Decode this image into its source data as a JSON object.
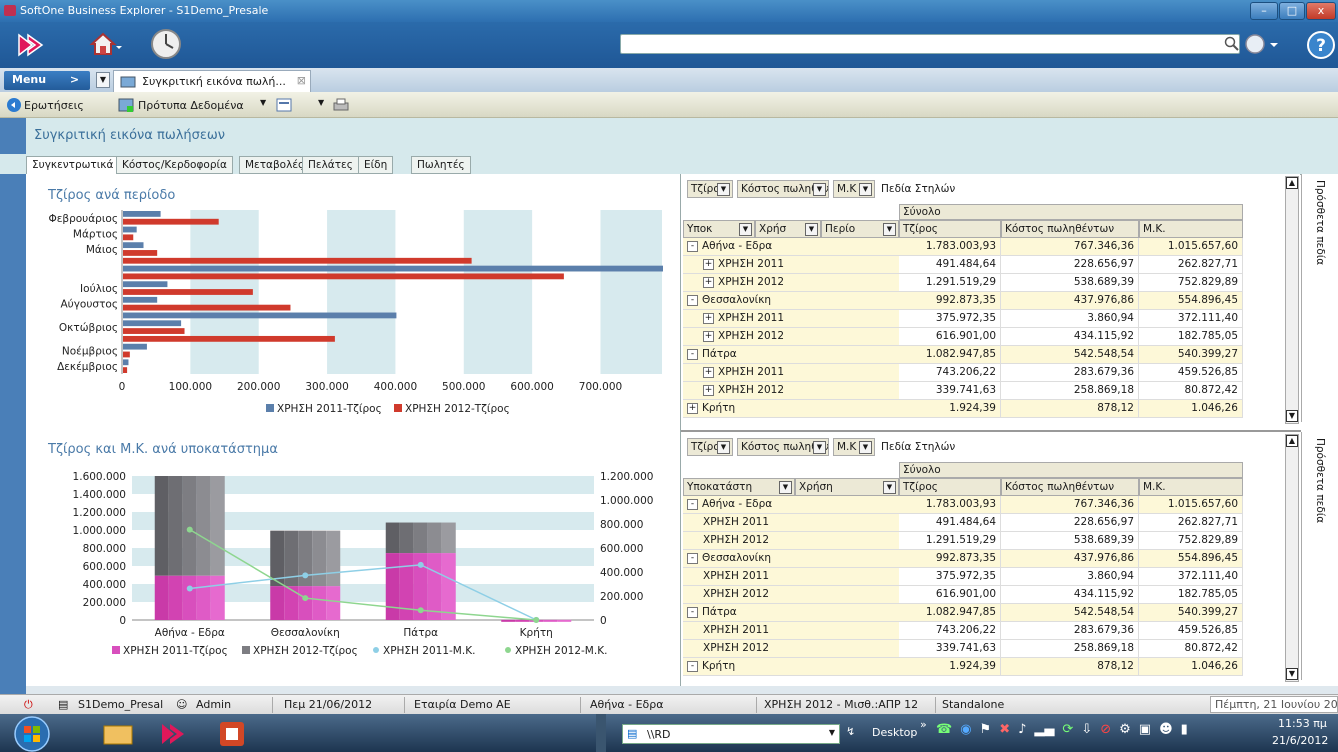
{
  "window": {
    "title": "SoftOne Business Explorer - S1Demo_Presale",
    "minimize": "–",
    "maximize": "□",
    "close": "x"
  },
  "menu": {
    "label": "Menu",
    "arrow": ">",
    "doc_tab": "Συγκριτική εικόνα πωλή..."
  },
  "commands": {
    "queries": "Ερωτήσεις",
    "templates": "Πρότυπα Δεδομένα"
  },
  "page_title": "Συγκριτική εικόνα πωλήσεων",
  "tabs": [
    "Συγκεντρωτικά",
    "Κόστος/Κερδοφορία",
    "Μεταβολές",
    "Πελάτες",
    "Είδη",
    "Πωλητές"
  ],
  "colors": {
    "blue": "#5b7fab",
    "red": "#d03a2c",
    "pink": "#d84fbd",
    "gray": "#7d7d82",
    "lightblue": "#8ecfe6",
    "green": "#8ed68f"
  },
  "chart1": {
    "title": "Τζίρος ανά περίοδο",
    "legend": [
      "ΧΡΗΣΗ 2011-Τζίρος",
      "ΧΡΗΣΗ 2012-Τζίρος"
    ],
    "tick_labels": [
      "0",
      "100.000",
      "200.000",
      "300.000",
      "400.000",
      "500.000",
      "600.000",
      "700.000"
    ]
  },
  "chart2": {
    "title": "Τζίρος και Μ.Κ. ανά υποκατάστημα",
    "left_ticks": [
      "1.600.000",
      "1.400.000",
      "1.200.000",
      "1.000.000",
      "800.000",
      "600.000",
      "400.000",
      "200.000",
      "0"
    ],
    "right_ticks": [
      "1.200.000",
      "1.000.000",
      "800.000",
      "600.000",
      "400.000",
      "200.000",
      "0"
    ],
    "legend": [
      "ΧΡΗΣΗ 2011-Τζίρος",
      "ΧΡΗΣΗ 2012-Τζίρος",
      "ΧΡΗΣΗ 2011-Μ.Κ.",
      "ΧΡΗΣΗ 2012-Μ.Κ."
    ]
  },
  "chart_data": [
    {
      "type": "bar",
      "orientation": "horizontal",
      "title": "Τζίρος ανά περίοδο",
      "categories": [
        "Φεβρουάριος",
        "Μάρτιος",
        "Μάιος",
        "Ιούλιος",
        "Αύγουστος",
        "Οκτώβριος",
        "Νοέμβριος",
        "Δεκέμβριος"
      ],
      "series": [
        {
          "name": "ΧΡΗΣΗ 2011-Τζίρος",
          "values": [
            55000,
            20000,
            30000,
            65000,
            50000,
            85000,
            35000,
            8000
          ]
        },
        {
          "name": "ΧΡΗΣΗ 2012-Τζίρος",
          "values": [
            140000,
            15000,
            50000,
            190000,
            245000,
            90000,
            10000,
            6000
          ]
        }
      ],
      "extra_bars": [
        {
          "after": "Μάιος",
          "series": "ΧΡΗΣΗ 2012-Τζίρος",
          "value": 510000
        },
        {
          "after": "Μάιος",
          "series": "ΧΡΗΣΗ 2011-Τζίρος",
          "value": 790000
        },
        {
          "after": "Μάιος",
          "series": "ΧΡΗΣΗ 2012-Τζίρος",
          "value": 645000
        },
        {
          "after": "Αύγουστος",
          "series": "ΧΡΗΣΗ 2011-Τζίρος",
          "value": 400000
        },
        {
          "after": "Οκτώβριος",
          "series": "ΧΡΗΣΗ 2012-Τζίρος",
          "value": 310000
        }
      ],
      "xlim": [
        0,
        790000
      ]
    },
    {
      "type": "bar",
      "stacked": true,
      "title": "Τζίρος και Μ.Κ. ανά υποκατάστημα",
      "categories": [
        "Αθήνα - Εδρα",
        "Θεσσαλονίκη",
        "Πάτρα",
        "Κρήτη"
      ],
      "series": [
        {
          "name": "ΧΡΗΣΗ 2011-Τζίρος",
          "values": [
            491484.64,
            375972.35,
            743206.22,
            1924.39
          ]
        },
        {
          "name": "ΧΡΗΣΗ 2012-Τζίρος",
          "values": [
            1291519.29,
            616901.0,
            339741.63,
            0
          ]
        }
      ],
      "lines": [
        {
          "name": "ΧΡΗΣΗ 2011-Μ.Κ.",
          "values": [
            262827.71,
            372111.4,
            459526.85,
            1046.26
          ]
        },
        {
          "name": "ΧΡΗΣΗ 2012-Μ.Κ.",
          "values": [
            752829.89,
            182785.05,
            80872.42,
            0
          ]
        }
      ],
      "ylim_left": [
        0,
        1600000
      ],
      "ylim_right": [
        0,
        1200000
      ]
    }
  ],
  "pivot1": {
    "fields": [
      "Τζίρος",
      "Κόστος πωληθέν",
      "Μ.Κ"
    ],
    "column_fields_label": "Πεδία Στηλών",
    "row_fields": [
      "Υποκ",
      "Χρήσ",
      "Περίο"
    ],
    "total_label": "Σύνολο",
    "headers": [
      "Τζίρος",
      "Κόστος πωληθέντων",
      "Μ.Κ."
    ],
    "side_label": "Πρόσθετα πεδία",
    "rows": [
      {
        "label": "Αθήνα - Εδρα",
        "level": 0,
        "sign": "-",
        "values": [
          "1.783.003,93",
          "767.346,36",
          "1.015.657,60"
        ]
      },
      {
        "label": "ΧΡΗΣΗ 2011",
        "level": 1,
        "sign": "+",
        "values": [
          "491.484,64",
          "228.656,97",
          "262.827,71"
        ]
      },
      {
        "label": "ΧΡΗΣΗ 2012",
        "level": 1,
        "sign": "+",
        "values": [
          "1.291.519,29",
          "538.689,39",
          "752.829,89"
        ]
      },
      {
        "label": "Θεσσαλονίκη",
        "level": 0,
        "sign": "-",
        "values": [
          "992.873,35",
          "437.976,86",
          "554.896,45"
        ]
      },
      {
        "label": "ΧΡΗΣΗ 2011",
        "level": 1,
        "sign": "+",
        "values": [
          "375.972,35",
          "3.860,94",
          "372.111,40"
        ]
      },
      {
        "label": "ΧΡΗΣΗ 2012",
        "level": 1,
        "sign": "+",
        "values": [
          "616.901,00",
          "434.115,92",
          "182.785,05"
        ]
      },
      {
        "label": "Πάτρα",
        "level": 0,
        "sign": "-",
        "values": [
          "1.082.947,85",
          "542.548,54",
          "540.399,27"
        ]
      },
      {
        "label": "ΧΡΗΣΗ 2011",
        "level": 1,
        "sign": "+",
        "values": [
          "743.206,22",
          "283.679,36",
          "459.526,85"
        ]
      },
      {
        "label": "ΧΡΗΣΗ 2012",
        "level": 1,
        "sign": "+",
        "values": [
          "339.741,63",
          "258.869,18",
          "80.872,42"
        ]
      },
      {
        "label": "Κρήτη",
        "level": 0,
        "sign": "+",
        "values": [
          "1.924,39",
          "878,12",
          "1.046,26"
        ]
      }
    ]
  },
  "pivot2": {
    "fields": [
      "Τζίρος",
      "Κόστος πωληθέν",
      "Μ.Κ"
    ],
    "column_fields_label": "Πεδία Στηλών",
    "row_fields": [
      "Υποκατάστη",
      "Χρήση"
    ],
    "total_label": "Σύνολο",
    "headers": [
      "Τζίρος",
      "Κόστος πωληθέντων",
      "Μ.Κ."
    ],
    "side_label": "Πρόσθετα πεδία",
    "rows": [
      {
        "label": "Αθήνα - Εδρα",
        "level": 0,
        "sign": "-",
        "values": [
          "1.783.003,93",
          "767.346,36",
          "1.015.657,60"
        ]
      },
      {
        "label": "ΧΡΗΣΗ 2011",
        "level": 1,
        "sign": "",
        "values": [
          "491.484,64",
          "228.656,97",
          "262.827,71"
        ]
      },
      {
        "label": "ΧΡΗΣΗ 2012",
        "level": 1,
        "sign": "",
        "values": [
          "1.291.519,29",
          "538.689,39",
          "752.829,89"
        ]
      },
      {
        "label": "Θεσσαλονίκη",
        "level": 0,
        "sign": "-",
        "values": [
          "992.873,35",
          "437.976,86",
          "554.896,45"
        ]
      },
      {
        "label": "ΧΡΗΣΗ 2011",
        "level": 1,
        "sign": "",
        "values": [
          "375.972,35",
          "3.860,94",
          "372.111,40"
        ]
      },
      {
        "label": "ΧΡΗΣΗ 2012",
        "level": 1,
        "sign": "",
        "values": [
          "616.901,00",
          "434.115,92",
          "182.785,05"
        ]
      },
      {
        "label": "Πάτρα",
        "level": 0,
        "sign": "-",
        "values": [
          "1.082.947,85",
          "542.548,54",
          "540.399,27"
        ]
      },
      {
        "label": "ΧΡΗΣΗ 2011",
        "level": 1,
        "sign": "",
        "values": [
          "743.206,22",
          "283.679,36",
          "459.526,85"
        ]
      },
      {
        "label": "ΧΡΗΣΗ 2012",
        "level": 1,
        "sign": "",
        "values": [
          "339.741,63",
          "258.869,18",
          "80.872,42"
        ]
      },
      {
        "label": "Κρήτη",
        "level": 0,
        "sign": "-",
        "values": [
          "1.924,39",
          "878,12",
          "1.046,26"
        ]
      }
    ]
  },
  "status": {
    "company_db": "S1Demo_Presal",
    "user": "Admin",
    "date": "Πεμ 21/06/2012",
    "company": "Εταιρία Demo AE",
    "branch": "Αθήνα - Εδρα",
    "period": "ΧΡΗΣΗ 2012 - Μισθ.:ΑΠΡ 12",
    "mode": "Standalone",
    "full_date": "Πέμπτη, 21 Ιουνίου 2012"
  },
  "taskbar": {
    "address": "\\\\RD",
    "desktop": "Desktop",
    "time": "11:53 πμ",
    "date": "21/6/2012"
  }
}
